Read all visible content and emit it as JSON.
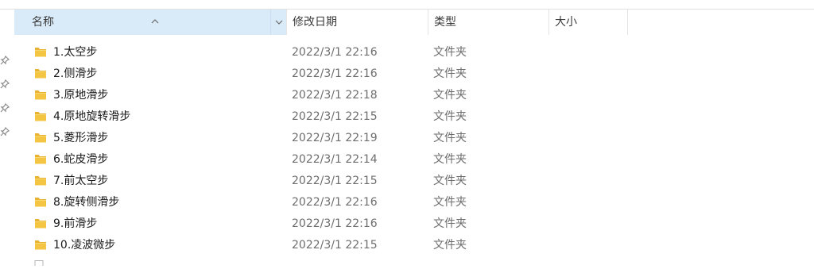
{
  "columns": {
    "name": "名称",
    "date": "修改日期",
    "type": "类型",
    "size": "大小"
  },
  "rows": [
    {
      "name": "1.太空步",
      "date": "2022/3/1 22:16",
      "type": "文件夹"
    },
    {
      "name": "2.侧滑步",
      "date": "2022/3/1 22:16",
      "type": "文件夹"
    },
    {
      "name": "3.原地滑步",
      "date": "2022/3/1 22:18",
      "type": "文件夹"
    },
    {
      "name": "4.原地旋转滑步",
      "date": "2022/3/1 22:15",
      "type": "文件夹"
    },
    {
      "name": "5.菱形滑步",
      "date": "2022/3/1 22:19",
      "type": "文件夹"
    },
    {
      "name": "6.蛇皮滑步",
      "date": "2022/3/1 22:14",
      "type": "文件夹"
    },
    {
      "name": "7.前太空步",
      "date": "2022/3/1 22:15",
      "type": "文件夹"
    },
    {
      "name": "8.旋转侧滑步",
      "date": "2022/3/1 22:16",
      "type": "文件夹"
    },
    {
      "name": "9.前滑步",
      "date": "2022/3/1 22:16",
      "type": "文件夹"
    },
    {
      "name": "10.凌波微步",
      "date": "2022/3/1 22:15",
      "type": "文件夹"
    }
  ],
  "icons": {
    "folder": "folder-icon",
    "pin": "pin-icon",
    "sort": "sort-ascending-icon",
    "chevron": "chevron-down-icon"
  },
  "colors": {
    "header_selected": "#d9ebf9",
    "folder_yellow": "#f4c542"
  }
}
